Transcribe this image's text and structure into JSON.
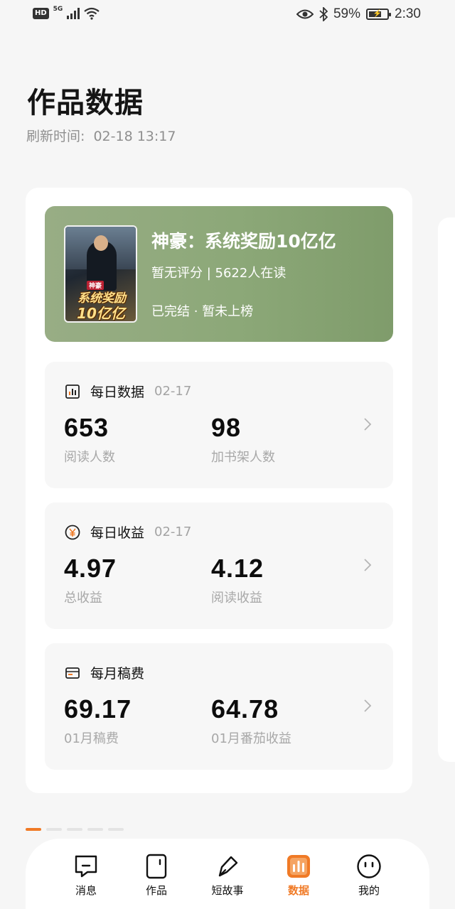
{
  "status_bar": {
    "hd": "HD",
    "network": "5G",
    "battery": "59%",
    "time": "2:30"
  },
  "header": {
    "title": "作品数据",
    "refresh_label": "刷新时间:",
    "refresh_time": "02-18 13:17"
  },
  "book": {
    "cover_tag": "神豪",
    "cover_title_1": "系统奖励",
    "cover_title_2": "10亿亿",
    "title": "神豪：系统奖励10亿亿",
    "rating": "暂无评分",
    "readers": "5622人在读",
    "status": "已完结",
    "rank": "暂未上榜"
  },
  "daily_data": {
    "title": "每日数据",
    "date": "02-17",
    "metric1_value": "653",
    "metric1_label": "阅读人数",
    "metric2_value": "98",
    "metric2_label": "加书架人数",
    "icon": "bar-chart-icon"
  },
  "daily_income": {
    "title": "每日收益",
    "date": "02-17",
    "metric1_value": "4.97",
    "metric1_label": "总收益",
    "metric2_value": "4.12",
    "metric2_label": "阅读收益",
    "icon": "yen-icon"
  },
  "monthly_fee": {
    "title": "每月稿费",
    "metric1_value": "69.17",
    "metric1_label": "01月稿费",
    "metric2_value": "64.78",
    "metric2_label": "01月番茄收益",
    "icon": "wallet-icon"
  },
  "tabs": [
    {
      "label": "消息",
      "icon": "message-icon"
    },
    {
      "label": "作品",
      "icon": "book-icon"
    },
    {
      "label": "短故事",
      "icon": "pen-icon"
    },
    {
      "label": "数据",
      "icon": "chart-icon",
      "active": true
    },
    {
      "label": "我的",
      "icon": "profile-icon"
    }
  ],
  "colors": {
    "accent": "#f07a26",
    "book_card": "#8ca878"
  }
}
